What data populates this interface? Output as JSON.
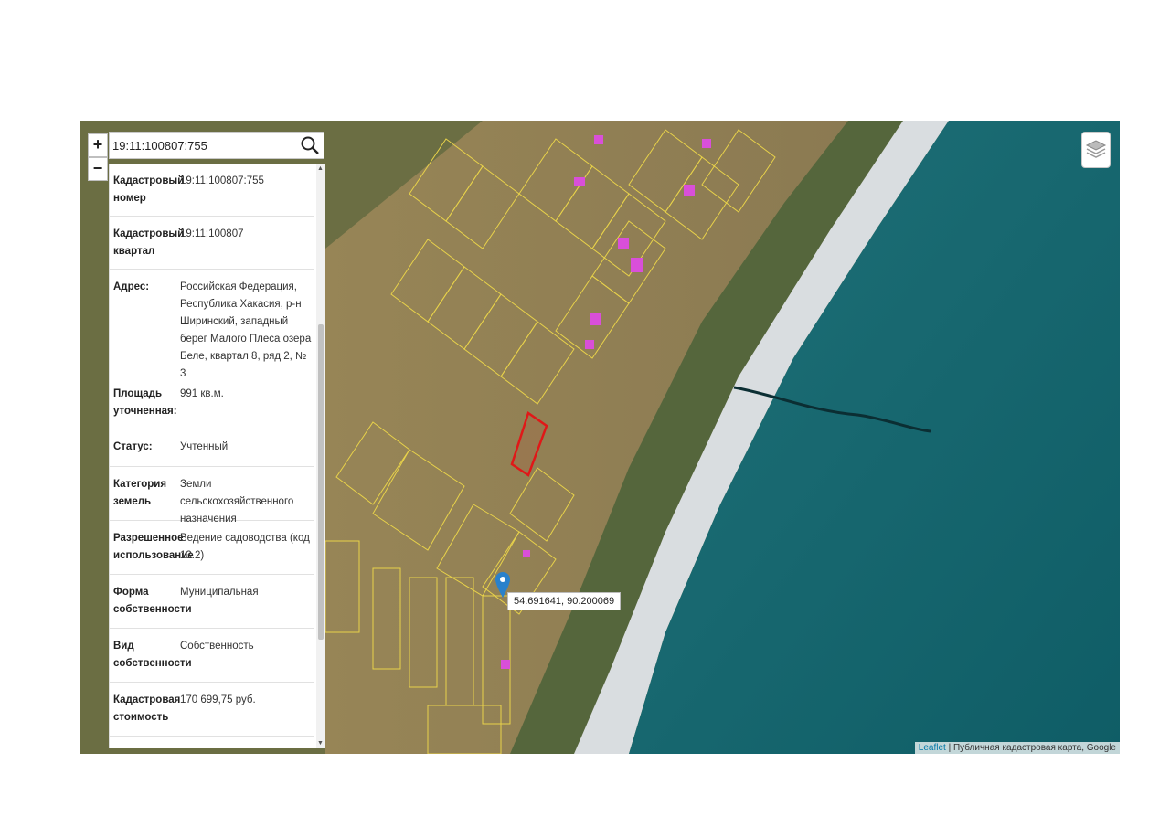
{
  "search": {
    "value": "19:11:100807:755"
  },
  "zoom": {
    "in_label": "+",
    "out_label": "−"
  },
  "info_rows": [
    {
      "label": "Кадастровый номер",
      "value": "19:11:100807:755"
    },
    {
      "label": "Кадастровый квартал",
      "value": "19:11:100807"
    },
    {
      "label": "Адрес:",
      "value": "Российская Федерация, Республика Хакасия, р-н Ширинский, западный берег Малого Плеса озера Беле, квартал 8, ряд 2, № 3"
    },
    {
      "label": "Площадь уточненная:",
      "value": "991 кв.м."
    },
    {
      "label": "Статус:",
      "value": "Учтенный"
    },
    {
      "label": "Категория земель",
      "value": "Земли сельскохозяйственного назначения"
    },
    {
      "label": "Разрешенное использование",
      "value": "Ведение садоводства (код 13.2)"
    },
    {
      "label": "Форма собственности",
      "value": "Муниципальная"
    },
    {
      "label": "Вид собственности",
      "value": "Собственность"
    },
    {
      "label": "Кадастровая стоимость",
      "value": "170 699,75 руб."
    }
  ],
  "marker": {
    "coords": "54.691641, 90.200069"
  },
  "attribution": {
    "link": "Leaflet",
    "text": " | Публичная кадастровая карта, Google"
  },
  "colors": {
    "water": "#17656d",
    "land": "#8f7d55",
    "parcel_outline": "#e8d24a",
    "selected_parcel": "#e01818",
    "building": "#d94fd9",
    "marker": "#2a81cb"
  }
}
